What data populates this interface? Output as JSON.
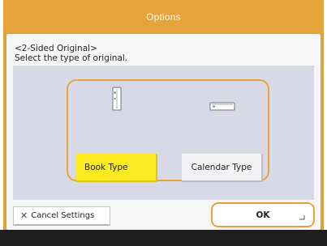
{
  "window": {
    "title": "Options"
  },
  "header": {
    "line1": "<2-Sided Original>",
    "line2": "Select the type of original."
  },
  "options": [
    {
      "label": "Book Type",
      "icon": "book-original-icon",
      "selected": true,
      "color": "#fbeb20"
    },
    {
      "label": "Calendar Type",
      "icon": "calendar-original-icon",
      "selected": false
    }
  ],
  "footer": {
    "cancel_label": "Cancel Settings",
    "cancel_icon": "close-icon",
    "ok_label": "OK"
  },
  "colors": {
    "accent": "#e6a33a",
    "selected": "#fbeb20",
    "content_bg": "#d7d9e6"
  }
}
